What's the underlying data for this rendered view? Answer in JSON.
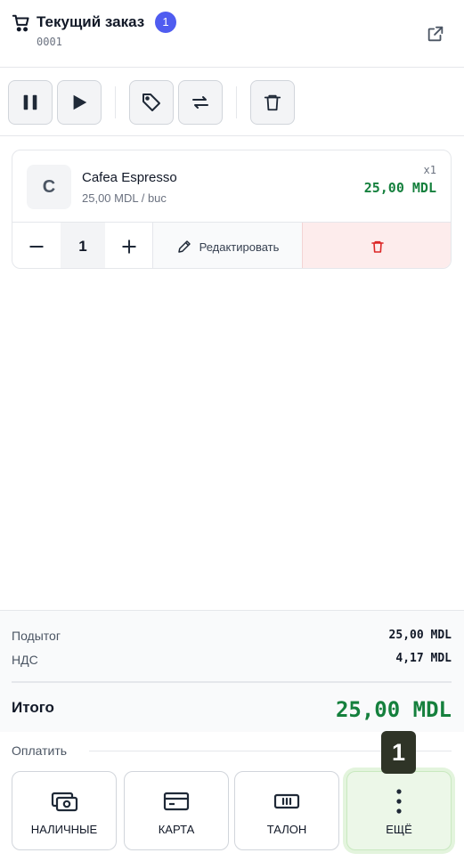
{
  "header": {
    "title": "Текущий заказ",
    "item_count": "1",
    "order_number": "0001"
  },
  "toolbar": {
    "buttons": [
      "pause",
      "play",
      "tag",
      "transfer",
      "delete"
    ]
  },
  "order_item": {
    "avatar_letter": "C",
    "name": "Cafea Espresso",
    "unit_price": "25,00 MDL / buc",
    "quantity_label": "x1",
    "total": "25,00 MDL",
    "quantity": "1",
    "edit_label": "Редактировать"
  },
  "summary": {
    "subtotal_label": "Подытог",
    "subtotal_value": "25,00 MDL",
    "vat_label": "НДС",
    "vat_value": "4,17 MDL",
    "total_label": "Итого",
    "total_value": "25,00 MDL"
  },
  "payment": {
    "heading": "Оплатить",
    "methods": [
      {
        "label": "НАЛИЧНЫЕ",
        "icon": "cash-icon"
      },
      {
        "label": "КАРТА",
        "icon": "card-icon"
      },
      {
        "label": "ТАЛОН",
        "icon": "ticket-icon"
      },
      {
        "label": "ЕЩЁ",
        "icon": "more-vertical-icon"
      }
    ]
  },
  "hint_badge": "1",
  "colors": {
    "accent_green": "#15803d",
    "badge_blue": "#4f5cf0",
    "delete_red": "#dc2626"
  }
}
